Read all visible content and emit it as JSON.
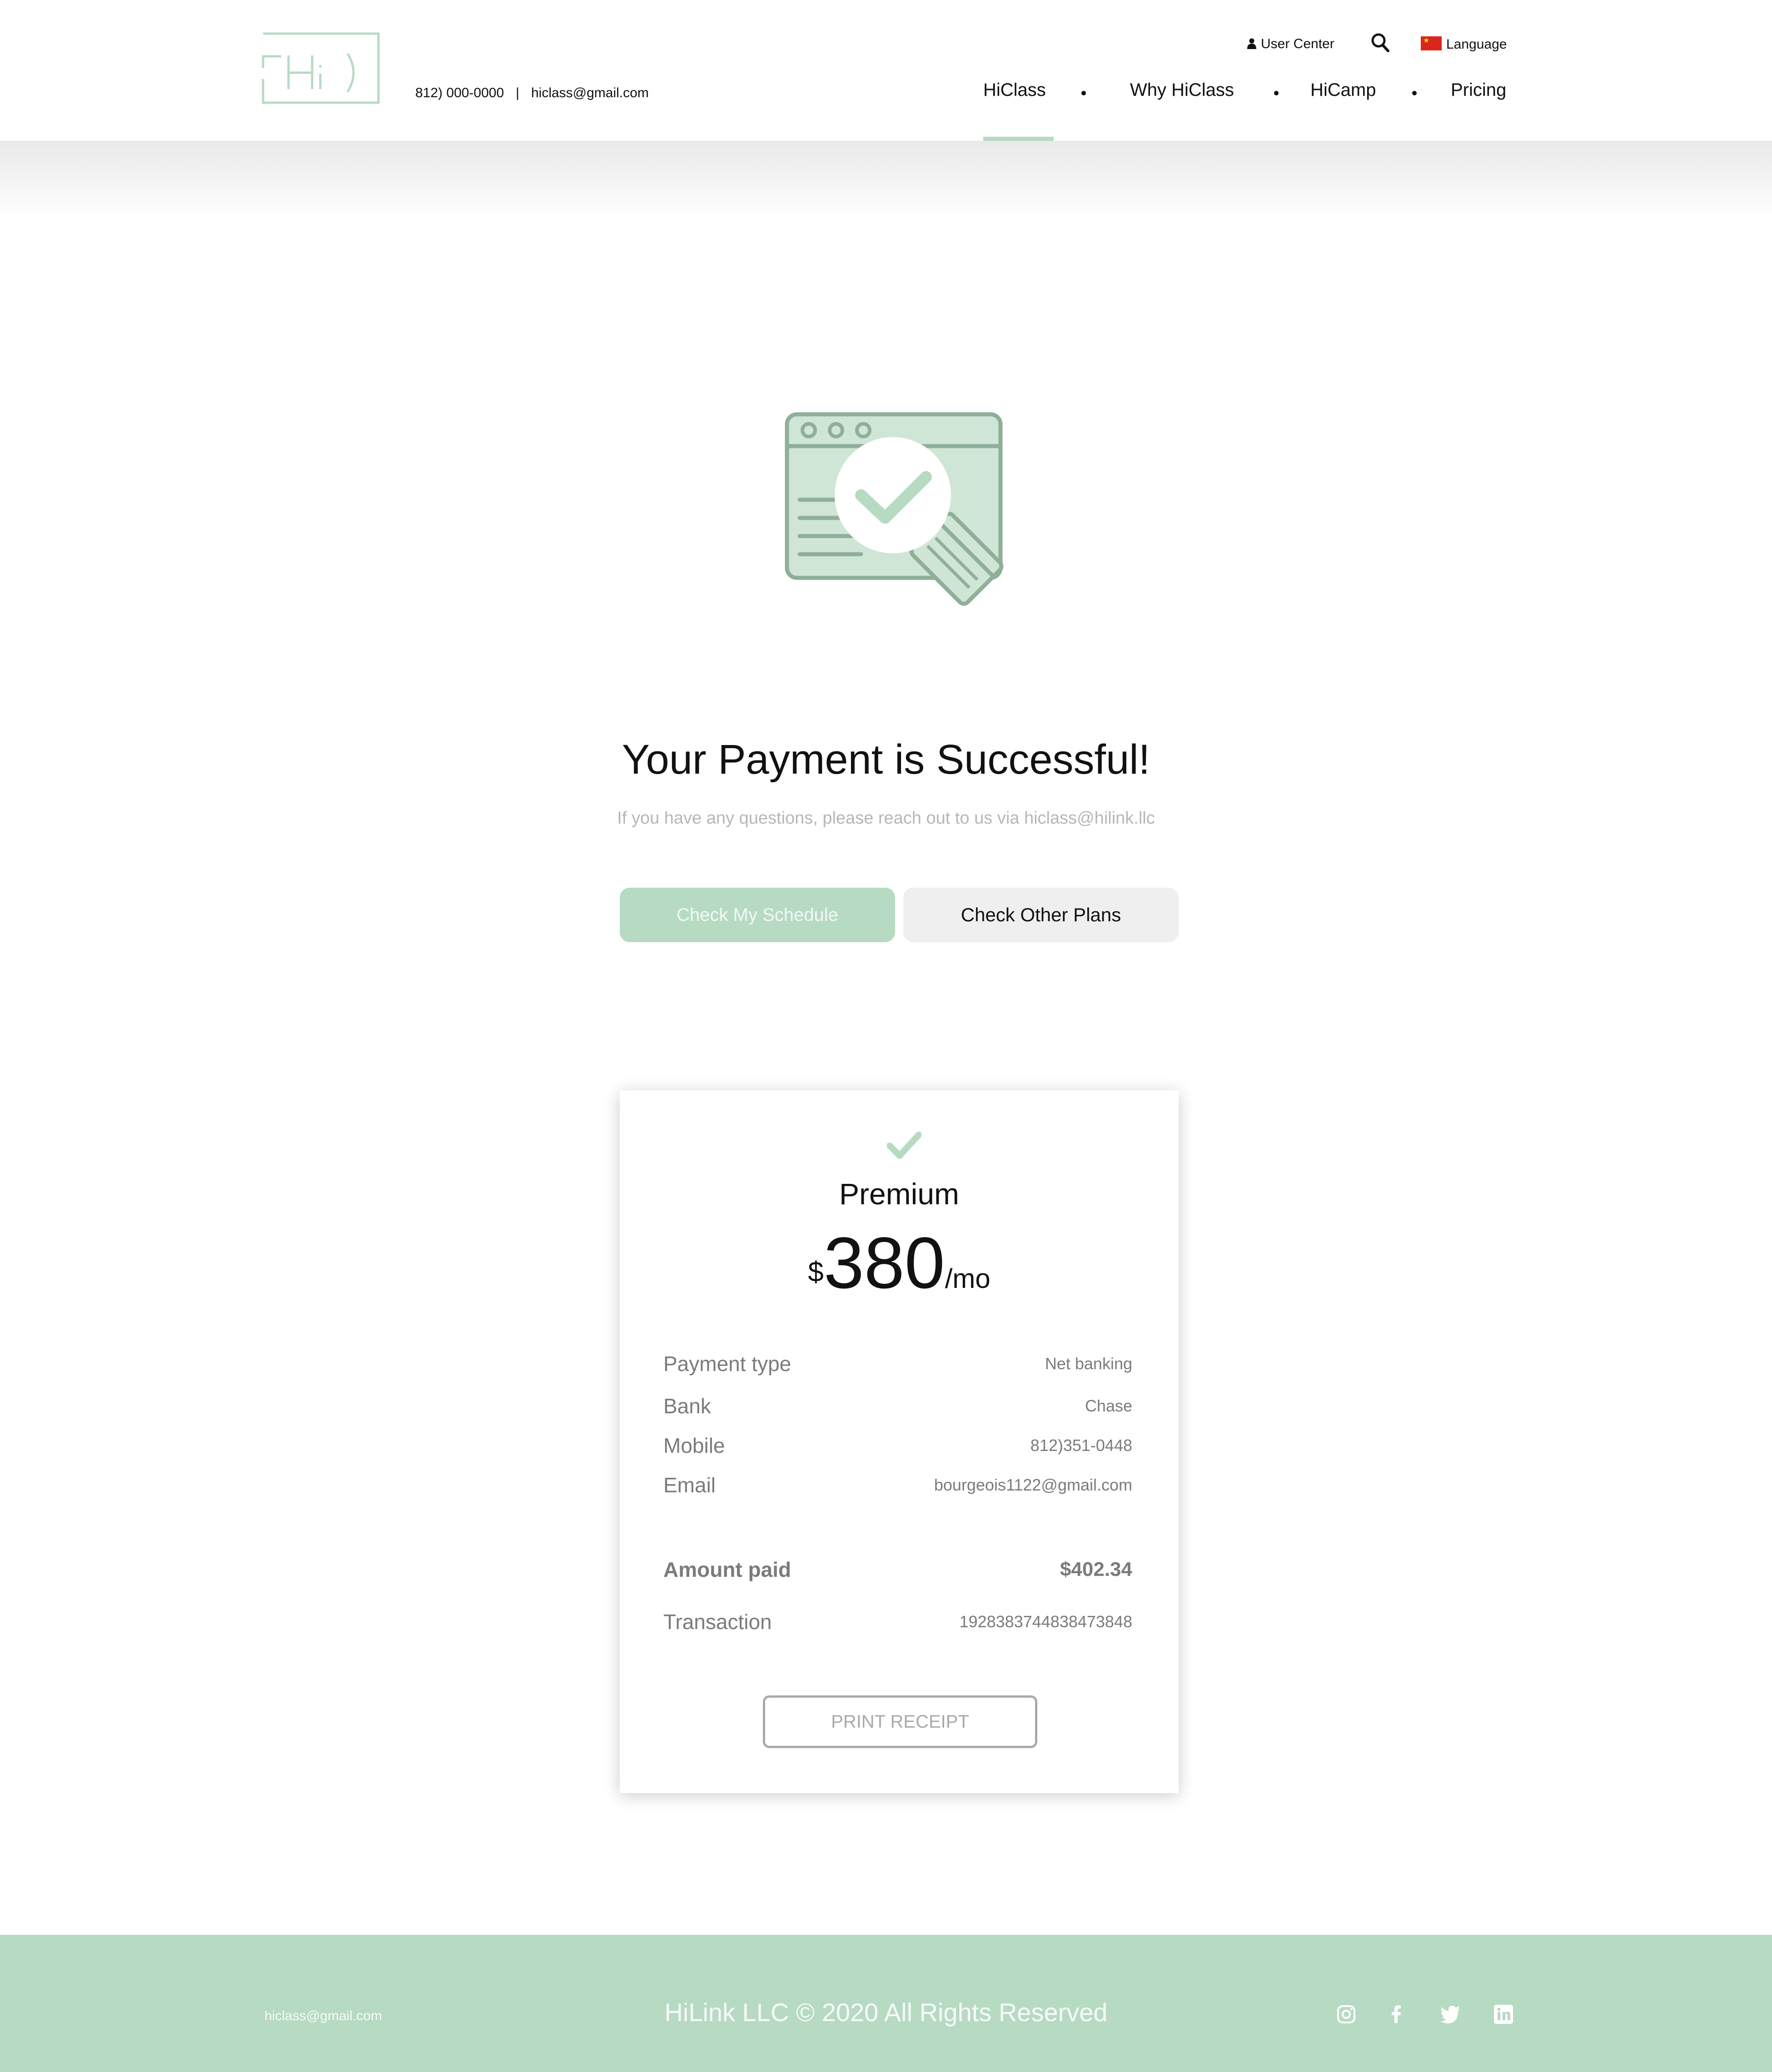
{
  "header": {
    "logo_text": "Hi)",
    "phone": "812) 000-0000",
    "separator": "|",
    "email": "hiclass@gmail.com",
    "utility": {
      "user_center": "User Center",
      "language": "Language"
    },
    "nav": [
      "HiClass",
      "Why HiClass",
      "HiCamp",
      "Pricing"
    ],
    "active_nav": "HiClass"
  },
  "main": {
    "title": "Your Payment is Successful!",
    "subtitle": "If you have any questions, please reach out to us via hiclass@hilink.llc",
    "primary_button": "Check My Schedule",
    "secondary_button": "Check Other Plans"
  },
  "receipt": {
    "plan": "Premium",
    "currency": "$",
    "price": "380",
    "period": "/mo",
    "rows": [
      {
        "label": "Payment type",
        "value": "Net banking"
      },
      {
        "label": "Bank",
        "value": "Chase"
      },
      {
        "label": "Mobile",
        "value": "812)351-0448"
      },
      {
        "label": "Email",
        "value": "bourgeois1122@gmail.com"
      },
      {
        "label": "Amount paid",
        "value": "$402.34"
      },
      {
        "label": "Transaction",
        "value": "1928383744838473848"
      }
    ],
    "print_button": "PRINT RECEIPT"
  },
  "footer": {
    "email": "hiclass@gmail.com",
    "copyright": "HiLink LLC © 2020 All Rights Reserved",
    "social": [
      "instagram-icon",
      "facebook-icon",
      "twitter-icon",
      "linkedin-icon"
    ]
  },
  "colors": {
    "accent": "#b7dac3",
    "illustration_stroke": "#8faf99",
    "illustration_fill": "#cfe6d6",
    "text_muted": "#7b7b7b"
  }
}
